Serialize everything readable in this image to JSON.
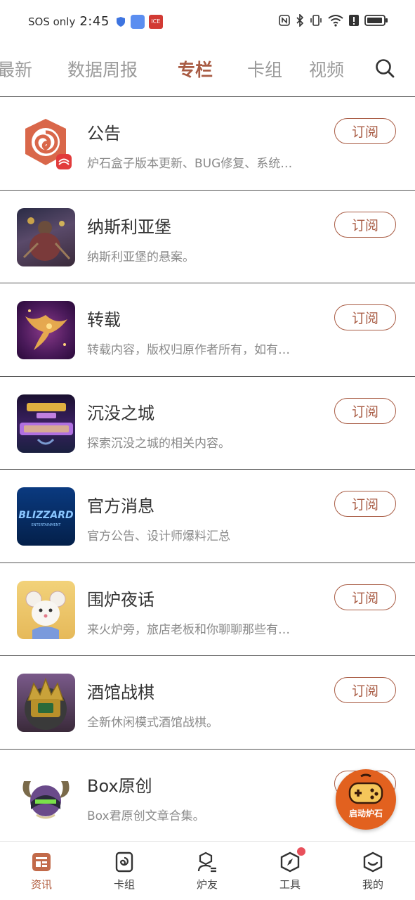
{
  "status_bar": {
    "carrier": "SOS only",
    "time": "2:45",
    "app_badge": "ICE"
  },
  "tabs": [
    {
      "label": "最新",
      "active": false
    },
    {
      "label": "数据周报",
      "active": false
    },
    {
      "label": "专栏",
      "active": true
    },
    {
      "label": "卡组",
      "active": false
    },
    {
      "label": "视频",
      "active": false
    }
  ],
  "subscribe_label": "订阅",
  "columns": [
    {
      "title": "公告",
      "desc": "炉石盒子版本更新、BUG修复、系统…",
      "icon": "hearthstone-logo-icon"
    },
    {
      "title": "纳斯利亚堡",
      "desc": "纳斯利亚堡的悬案。",
      "icon": "nathria-art-icon"
    },
    {
      "title": "转载",
      "desc": "转载内容，版权归原作者所有，如有…",
      "icon": "phoenix-art-icon"
    },
    {
      "title": "沉没之城",
      "desc": "探索沉没之城的相关内容。",
      "icon": "sunken-city-icon"
    },
    {
      "title": "官方消息",
      "desc": "官方公告、设计师爆料汇总",
      "icon": "blizzard-logo-icon"
    },
    {
      "title": "围炉夜话",
      "desc": "来火炉旁，旅店老板和你聊聊那些有…",
      "icon": "mouse-character-icon"
    },
    {
      "title": "酒馆战棋",
      "desc": "全新休闲模式酒馆战棋。",
      "icon": "battlegrounds-crown-icon"
    },
    {
      "title": "Box原创",
      "desc": "Box君原创文章合集。",
      "icon": "illidan-avatar-icon"
    }
  ],
  "blizzard_logo_text": "BLIZZARD",
  "blizzard_logo_sub": "ENTERTAINMENT",
  "launch_button": {
    "label": "启动炉石"
  },
  "bottom_nav": [
    {
      "label": "资讯",
      "icon": "news-icon",
      "active": true,
      "badge": false
    },
    {
      "label": "卡组",
      "icon": "deck-icon",
      "active": false,
      "badge": false
    },
    {
      "label": "炉友",
      "icon": "friends-icon",
      "active": false,
      "badge": false
    },
    {
      "label": "工具",
      "icon": "compass-icon",
      "active": false,
      "badge": true
    },
    {
      "label": "我的",
      "icon": "profile-icon",
      "active": false,
      "badge": false
    }
  ],
  "colors": {
    "accent": "#a85b43",
    "launch": "#e2611f",
    "badge": "#e8505b"
  }
}
